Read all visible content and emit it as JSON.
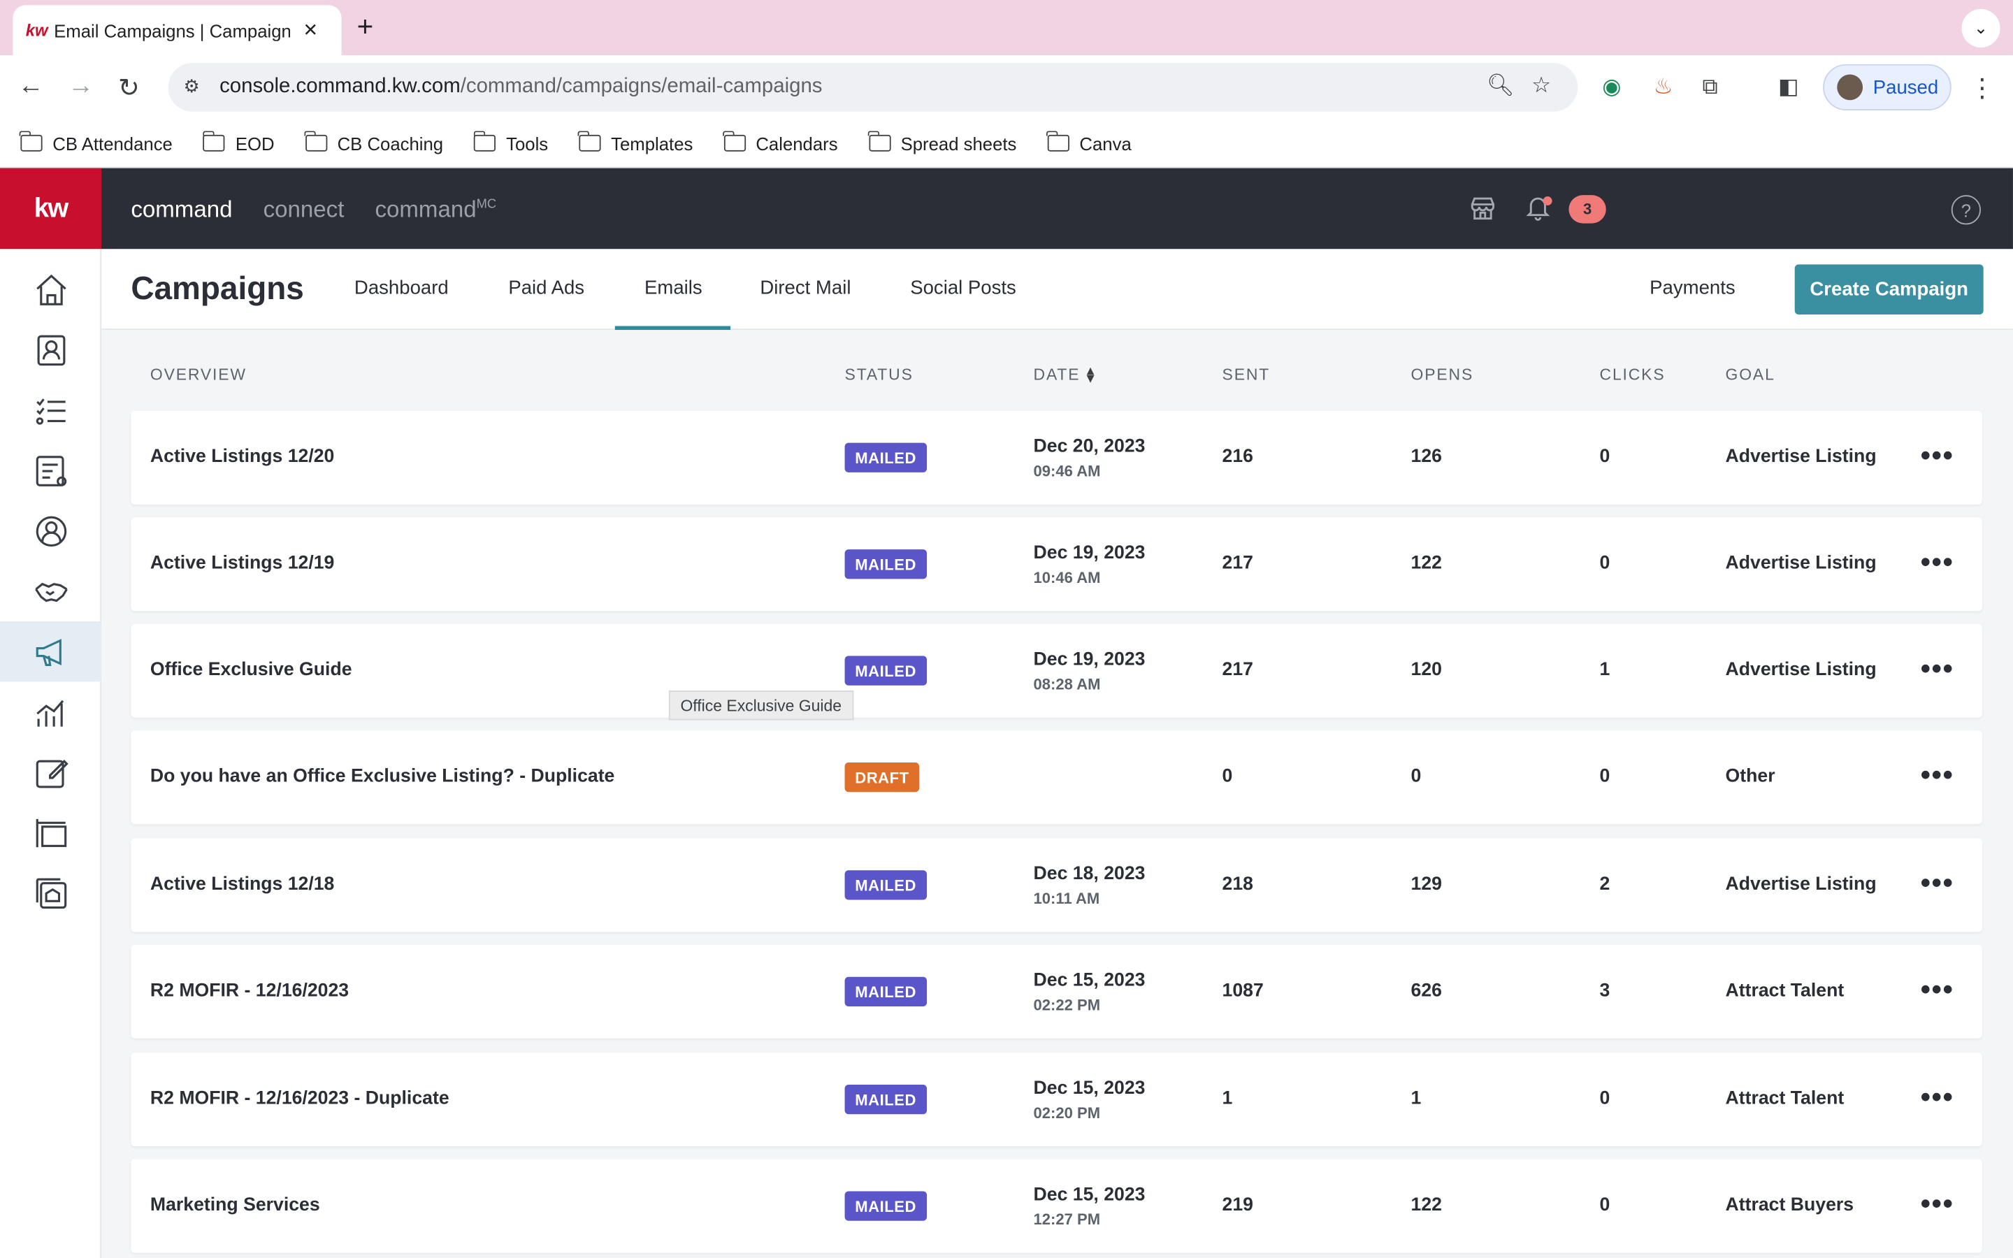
{
  "browser": {
    "tab_title": "Email Campaigns | Campaigns",
    "url_domain": "console.command.kw.com",
    "url_path": "/command/campaigns/email-campaigns",
    "profile_label": "Paused",
    "bookmarks": [
      "CB Attendance",
      "EOD",
      "CB Coaching",
      "Tools",
      "Templates",
      "Calendars",
      "Spread sheets",
      "Canva"
    ]
  },
  "app": {
    "logo": "kw",
    "nav": [
      "command",
      "connect",
      "command"
    ],
    "nav_sup": "MC",
    "notification_count": "3",
    "help": "?"
  },
  "page": {
    "title": "Campaigns",
    "tabs": [
      "Dashboard",
      "Paid Ads",
      "Emails",
      "Direct Mail",
      "Social Posts"
    ],
    "active_tab": "Emails",
    "payments_label": "Payments",
    "create_label": "Create Campaign"
  },
  "table": {
    "headers": {
      "overview": "OVERVIEW",
      "status": "STATUS",
      "date": "DATE",
      "sent": "SENT",
      "opens": "OPENS",
      "clicks": "CLICKS",
      "goal": "GOAL"
    },
    "rows": [
      {
        "name": "Active Listings 12/20",
        "status": "MAILED",
        "date": "Dec 20, 2023",
        "time": "09:46 AM",
        "sent": "216",
        "opens": "126",
        "clicks": "0",
        "goal": "Advertise Listing"
      },
      {
        "name": "Active Listings 12/19",
        "status": "MAILED",
        "date": "Dec 19, 2023",
        "time": "10:46 AM",
        "sent": "217",
        "opens": "122",
        "clicks": "0",
        "goal": "Advertise Listing"
      },
      {
        "name": "Office Exclusive Guide",
        "status": "MAILED",
        "date": "Dec 19, 2023",
        "time": "08:28 AM",
        "sent": "217",
        "opens": "120",
        "clicks": "1",
        "goal": "Advertise Listing"
      },
      {
        "name": "Do you have an Office Exclusive Listing? - Duplicate",
        "status": "DRAFT",
        "date": "",
        "time": "",
        "sent": "0",
        "opens": "0",
        "clicks": "0",
        "goal": "Other"
      },
      {
        "name": "Active Listings 12/18",
        "status": "MAILED",
        "date": "Dec 18, 2023",
        "time": "10:11 AM",
        "sent": "218",
        "opens": "129",
        "clicks": "2",
        "goal": "Advertise Listing"
      },
      {
        "name": "R2 MOFIR - 12/16/2023",
        "status": "MAILED",
        "date": "Dec 15, 2023",
        "time": "02:22 PM",
        "sent": "1087",
        "opens": "626",
        "clicks": "3",
        "goal": "Attract Talent"
      },
      {
        "name": "R2 MOFIR - 12/16/2023 - Duplicate",
        "status": "MAILED",
        "date": "Dec 15, 2023",
        "time": "02:20 PM",
        "sent": "1",
        "opens": "1",
        "clicks": "0",
        "goal": "Attract Talent"
      },
      {
        "name": "Marketing Services",
        "status": "MAILED",
        "date": "Dec 15, 2023",
        "time": "12:27 PM",
        "sent": "219",
        "opens": "122",
        "clicks": "0",
        "goal": "Attract Buyers"
      }
    ],
    "row_menu": "•••",
    "tooltip": "Office Exclusive Guide"
  },
  "colors": {
    "brand_red": "#c8102e",
    "appbar": "#2b2e36",
    "accent_teal": "#3a8fa0",
    "mailed": "#5a55c8",
    "draft": "#e06f2a"
  }
}
